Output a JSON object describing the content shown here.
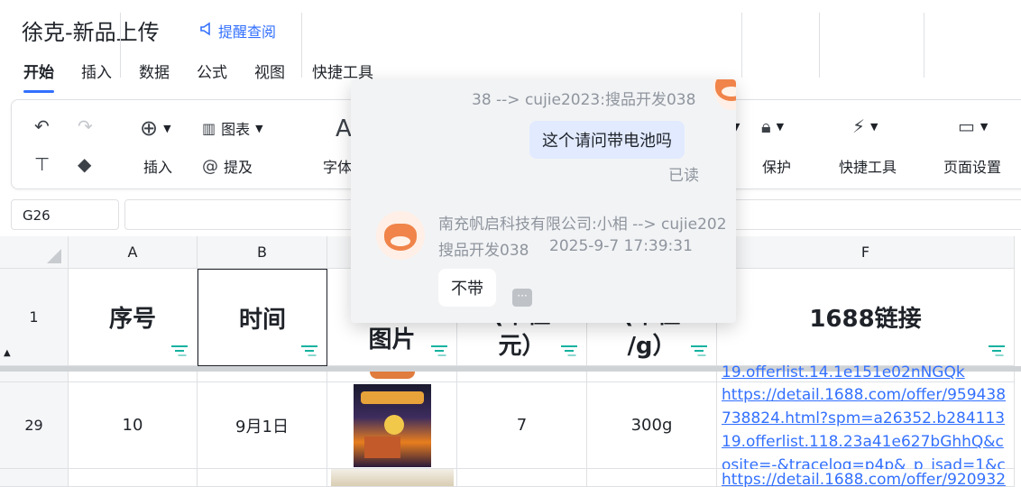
{
  "header": {
    "title": "徐克-新品上传",
    "remind_label": "提醒查阅"
  },
  "menu": [
    "开始",
    "插入",
    "数据",
    "公式",
    "视图",
    "快捷工具"
  ],
  "ribbon": {
    "insert_label": "插入",
    "chart_label": "图表",
    "mention_label": "提及",
    "font_label": "字体",
    "protect_label": "保护",
    "quick_tools_label": "快捷工具",
    "page_setup_label": "页面设置"
  },
  "formula_bar": {
    "cell_ref": "G26"
  },
  "columns": [
    "A",
    "B",
    "F"
  ],
  "row1": {
    "number": "1",
    "a": "序号",
    "b": "时间",
    "c": "图片",
    "d1": "(单位",
    "d2": "元）",
    "e1": "(单位",
    "e2": "/g）",
    "f": "1688链接"
  },
  "row29": {
    "number": "29",
    "a": "10",
    "b": "9月1日",
    "d": "7",
    "e": "300g"
  },
  "partial_link_top": "19.offerlist.14.1e151e02nNGQk",
  "row29_link": [
    "https://detail.1688.com/offer/959438",
    "738824.html?spm=a26352.b284113",
    "19.offerlist.118.23a41e627bGhhQ&c",
    "osite=-&tracelog=p4p&_p_isad=1&c"
  ],
  "next_link": "https://detail.1688.com/offer/920932",
  "chat": {
    "top_line": "38 --> cujie2023:搜品开发038",
    "question": "这个请问带电池吗",
    "read_status": "已读",
    "sender_line1": "南充帆启科技有限公司:小相 --> cujie202",
    "sender_name2": "搜品开发038",
    "timestamp": "2025-9-7 17:39:31",
    "answer": "不带",
    "more_icon": "···"
  },
  "colors": {
    "accent": "#3370ff",
    "filter": "#14b2a0"
  }
}
